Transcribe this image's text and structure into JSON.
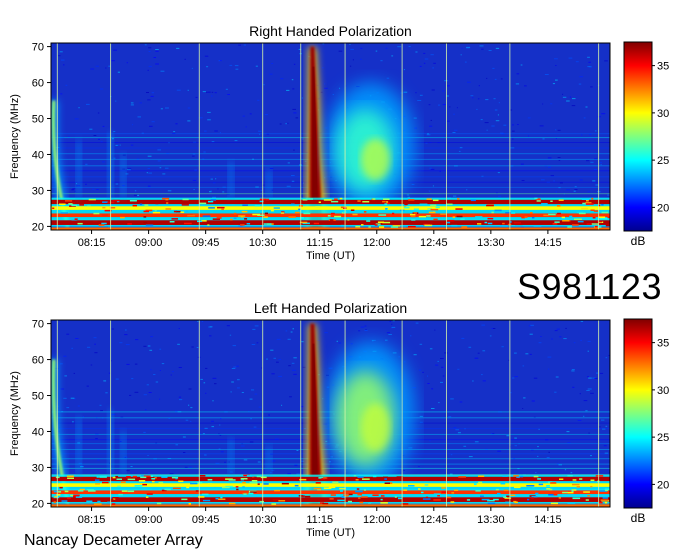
{
  "page": {
    "date_code": "S981123",
    "observatory": "Nancay Decameter Array"
  },
  "chart_data": [
    {
      "type": "heatmap",
      "title": "Right Handed Polarization",
      "xlabel": "Time (UT)",
      "ylabel": "Frequency (MHz)",
      "x_ticks": [
        "08:15",
        "09:00",
        "09:45",
        "10:30",
        "11:15",
        "12:00",
        "12:45",
        "13:30",
        "14:15"
      ],
      "x_range": [
        "07:43",
        "15:04"
      ],
      "y_ticks": [
        20,
        30,
        40,
        50,
        60,
        70
      ],
      "ylim": [
        19,
        71
      ],
      "colorbar": {
        "label": "dB",
        "ticks": [
          20,
          25,
          30,
          35
        ],
        "range": [
          17.5,
          37.5
        ],
        "colormap": "jet"
      },
      "features": [
        {
          "name": "bright burst",
          "time": "11:10",
          "freq_range": [
            20,
            70
          ],
          "intensity_db": 37
        },
        {
          "name": "diffuse emission",
          "time_range": [
            "11:20",
            "12:30"
          ],
          "freq_range": [
            25,
            60
          ],
          "intensity_db": 26
        },
        {
          "name": "early arc",
          "time": "07:50",
          "freq_range": [
            20,
            55
          ],
          "intensity_db": 28
        },
        {
          "name": "interference band",
          "freq_range": [
            20,
            28
          ],
          "intensity_db": 35
        }
      ]
    },
    {
      "type": "heatmap",
      "title": "Left Handed Polarization",
      "xlabel": "Time (UT)",
      "ylabel": "Frequency (MHz)",
      "x_ticks": [
        "08:15",
        "09:00",
        "09:45",
        "10:30",
        "11:15",
        "12:00",
        "12:45",
        "13:30",
        "14:15"
      ],
      "x_range": [
        "07:43",
        "15:04"
      ],
      "y_ticks": [
        20,
        30,
        40,
        50,
        60,
        70
      ],
      "ylim": [
        19,
        71
      ],
      "colorbar": {
        "label": "dB",
        "ticks": [
          20,
          25,
          30,
          35
        ],
        "range": [
          17.5,
          37.5
        ],
        "colormap": "jet"
      },
      "features": [
        {
          "name": "bright burst",
          "time": "11:10",
          "freq_range": [
            20,
            70
          ],
          "intensity_db": 37
        },
        {
          "name": "diffuse emission",
          "time_range": [
            "11:20",
            "12:30"
          ],
          "freq_range": [
            25,
            65
          ],
          "intensity_db": 28
        },
        {
          "name": "early arc",
          "time": "07:50",
          "freq_range": [
            20,
            60
          ],
          "intensity_db": 28
        },
        {
          "name": "interference band",
          "freq_range": [
            20,
            28
          ],
          "intensity_db": 35
        }
      ]
    }
  ]
}
